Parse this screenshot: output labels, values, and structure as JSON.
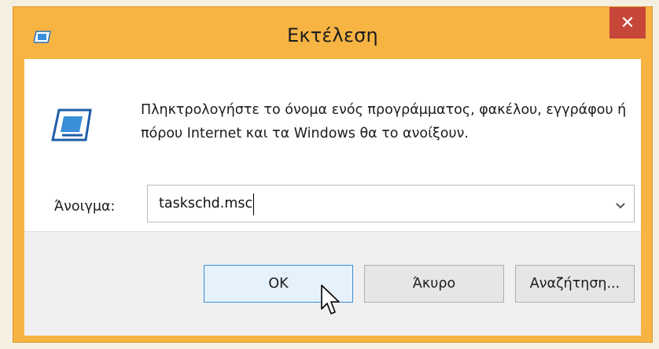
{
  "window": {
    "title": "Εκτέλεση",
    "close_glyph": "✕",
    "title_icon": "run-icon",
    "close_color": "#c7463a",
    "frame_color": "#f7b443"
  },
  "content": {
    "icon": "run-icon",
    "message": "Πληκτρολογήστε το όνομα ενός προγράμματος, φακέλου, εγγράφου ή πόρου Internet και τα Windows θα το ανοίξουν."
  },
  "open_field": {
    "label": "Άνοιγμα:",
    "value": "taskschd.msc",
    "dropdown_icon": "chevron-down-icon"
  },
  "buttons": {
    "ok": "OK",
    "cancel": "Άκυρο",
    "browse": "Αναζήτηση..."
  }
}
